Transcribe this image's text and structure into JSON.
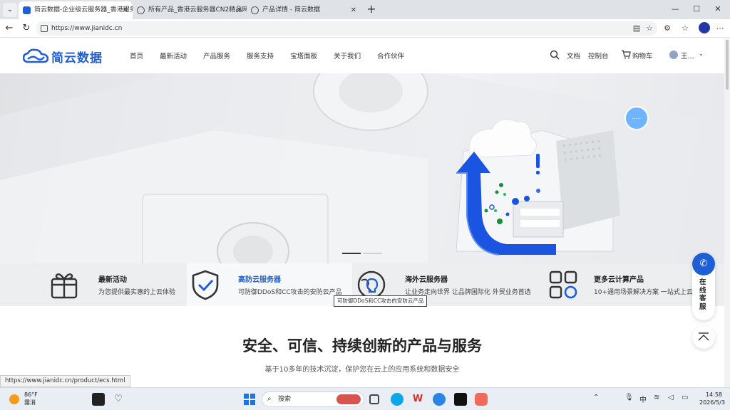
{
  "browser": {
    "tabs": [
      {
        "title": "简云数据-企业级云服务器_香港服务器",
        "active": true
      },
      {
        "title": "所有产品_香港云服务器CN2精品网",
        "active": false
      },
      {
        "title": "产品详情 - 简云数据",
        "active": false
      }
    ],
    "url": "https://www.jianidc.cn",
    "status_url": "https://www.jianidc.cn/product/ecs.html"
  },
  "site": {
    "logo_text": "简云数据",
    "nav": [
      "首页",
      "最新活动",
      "产品服务",
      "服务支持",
      "宝塔面板",
      "关于我们",
      "合作伙伴"
    ],
    "header_right": {
      "docs": "文档",
      "console": "控制台",
      "cart": "购物车",
      "user": "王..."
    },
    "hero": {
      "slide_count": 2,
      "active_slide": 0
    },
    "features": [
      {
        "title": "最新活动",
        "desc": "为您提供最实惠的上云体验",
        "icon": "gift-icon"
      },
      {
        "title": "高防云服务器",
        "desc": "可防御DDoS和CC攻击的安防云产品",
        "icon": "shield-check-icon",
        "highlight": true
      },
      {
        "title": "海外云服务器",
        "desc": "让业务走向世界 让品牌国际化 外贸业务首选",
        "icon": "globe-bulb-icon"
      },
      {
        "title": "更多云计算产品",
        "desc": "10+通用场景解决方案 一站式上云",
        "icon": "apps-grid-icon"
      }
    ],
    "tooltip": "可防御DDoS和CC攻击的安防云产品",
    "section": {
      "title": "安全、可信、持续创新的产品与服务",
      "subtitle": "基于10多年的技术沉淀，保护您在云上的应用系统和数据安全"
    },
    "float_cs": "在线客服",
    "brand_color": "#1f5fd6"
  },
  "taskbar": {
    "weather_temp": "86°F",
    "weather_desc": "霧消",
    "search_label": "搜索",
    "ime": "中",
    "time": "14:58",
    "date": "2026/5/3"
  }
}
